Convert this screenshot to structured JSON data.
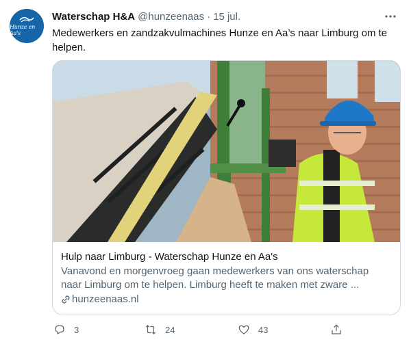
{
  "tweet": {
    "display_name": "Waterschap H&A",
    "handle": "@hunzeenaas",
    "separator": "·",
    "date": "15 jul.",
    "text": "Medewerkers en zandzakvulmachines Hunze en Aa’s naar Limburg om te helpen.",
    "avatar_text": "Hunze en Aa's"
  },
  "card": {
    "title": "Hulp naar Limburg - Waterschap Hunze en Aa's",
    "description": "Vanavond en morgenvroeg gaan medewerkers van ons waterschap naar Limburg om te helpen. Limburg heeft te maken met zware ...",
    "domain": "hunzeenaas.nl"
  },
  "actions": {
    "reply_count": "3",
    "retweet_count": "24",
    "like_count": "43"
  },
  "colors": {
    "text_primary": "#0f1419",
    "text_secondary": "#536471",
    "border": "#cfd9de",
    "avatar_bg": "#1565a8"
  },
  "icons": {
    "more": "more-horizontal-icon",
    "link": "link-icon",
    "reply": "reply-icon",
    "retweet": "retweet-icon",
    "like": "heart-icon",
    "share": "share-icon"
  }
}
